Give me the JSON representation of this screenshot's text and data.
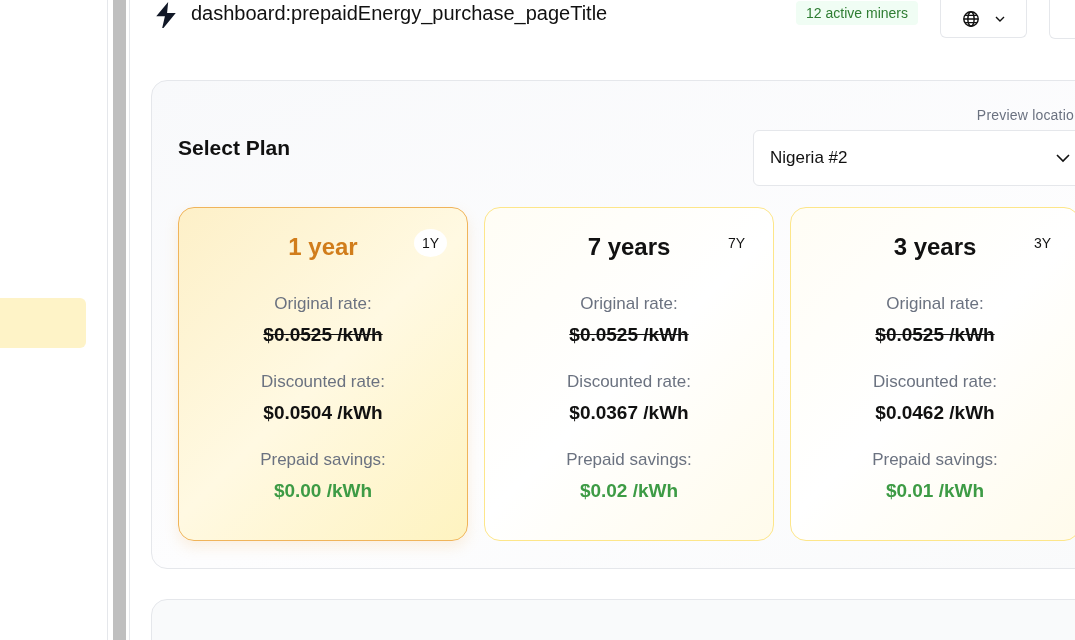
{
  "header": {
    "title": "dashboard:prepaidEnergy_purchase_pageTitle",
    "badge": "12 active miners"
  },
  "plan_section": {
    "title": "Select Plan",
    "location_label": "Preview locatio",
    "location": "Nigeria #2",
    "plans": [
      {
        "title": "1 year",
        "code": "1Y",
        "selected": true,
        "original_label": "Original rate:",
        "original_rate": "$0.0525 /kWh",
        "discounted_label": "Discounted rate:",
        "discounted_rate": "$0.0504 /kWh",
        "savings_label": "Prepaid savings:",
        "savings": "$0.00 /kWh"
      },
      {
        "title": "7 years",
        "code": "7Y",
        "selected": false,
        "original_label": "Original rate:",
        "original_rate": "$0.0525 /kWh",
        "discounted_label": "Discounted rate:",
        "discounted_rate": "$0.0367 /kWh",
        "savings_label": "Prepaid savings:",
        "savings": "$0.02 /kWh"
      },
      {
        "title": "3 years",
        "code": "3Y",
        "selected": false,
        "original_label": "Original rate:",
        "original_rate": "$0.0525 /kWh",
        "discounted_label": "Discounted rate:",
        "discounted_rate": "$0.0462 /kWh",
        "savings_label": "Prepaid savings:",
        "savings": "$0.01 /kWh"
      }
    ]
  }
}
